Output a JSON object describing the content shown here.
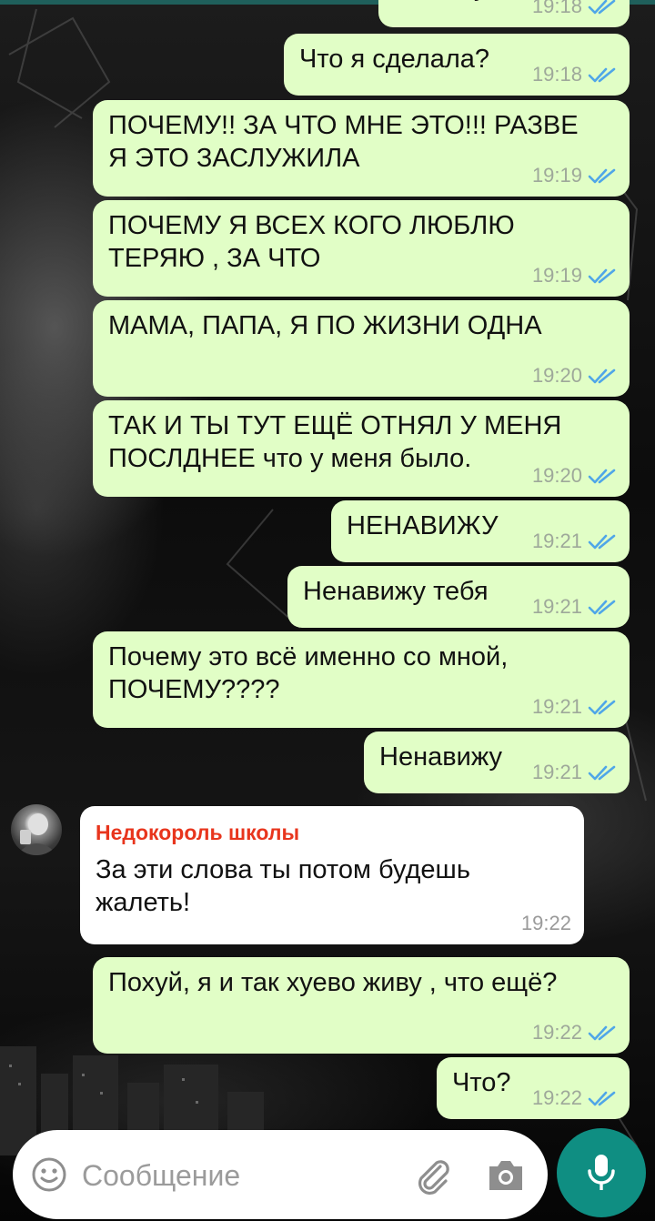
{
  "colors": {
    "outgoing_bubble": "#e1fec6",
    "incoming_bubble": "#ffffff",
    "read_check": "#4fa6e8",
    "sender_name": "#e8351d",
    "mic_button": "#0f8e82"
  },
  "messages": [
    {
      "dir": "out",
      "text": "Почему?",
      "time": "19:18",
      "status": "read"
    },
    {
      "dir": "out",
      "text": "Что я сделала?",
      "time": "19:18",
      "status": "read"
    },
    {
      "dir": "out",
      "text": "ПОЧЕМУ!! ЗА ЧТО МНЕ ЭТО!!! РАЗВЕ\nЯ ЭТО ЗАСЛУЖИЛА",
      "time": "19:19",
      "status": "read"
    },
    {
      "dir": "out",
      "text": "ПОЧЕМУ Я ВСЕХ КОГО ЛЮБЛЮ\nТЕРЯЮ , ЗА ЧТО",
      "time": "19:19",
      "status": "read"
    },
    {
      "dir": "out",
      "text": "МАМА, ПАПА, Я ПО ЖИЗНИ ОДНА",
      "time": "19:20",
      "status": "read"
    },
    {
      "dir": "out",
      "text": "ТАК И ТЫ ТУТ ЕЩЁ ОТНЯЛ У МЕНЯ\nПОСЛДНЕЕ что у меня было.",
      "time": "19:20",
      "status": "read"
    },
    {
      "dir": "out",
      "text": "НЕНАВИЖУ",
      "time": "19:21",
      "status": "read"
    },
    {
      "dir": "out",
      "text": "Ненавижу тебя",
      "time": "19:21",
      "status": "read"
    },
    {
      "dir": "out",
      "text": "Почему это всё именно со мной,\nПОЧЕМУ????",
      "time": "19:21",
      "status": "read"
    },
    {
      "dir": "out",
      "text": "Ненавижу",
      "time": "19:21",
      "status": "read"
    },
    {
      "dir": "in",
      "sender": "Недокороль школы",
      "text": "За эти слова ты потом будешь\nжалеть!",
      "time": "19:22"
    },
    {
      "dir": "out",
      "text": "Похуй, я и так хуево живу , что ещё?",
      "time": "19:22",
      "status": "read"
    },
    {
      "dir": "out",
      "text": "Что?",
      "time": "19:22",
      "status": "read"
    }
  ],
  "composer": {
    "placeholder": "Сообщение",
    "emoji_icon": "smiley-icon",
    "attach_icon": "paperclip-icon",
    "camera_icon": "camera-icon",
    "send_icon": "microphone-icon"
  }
}
